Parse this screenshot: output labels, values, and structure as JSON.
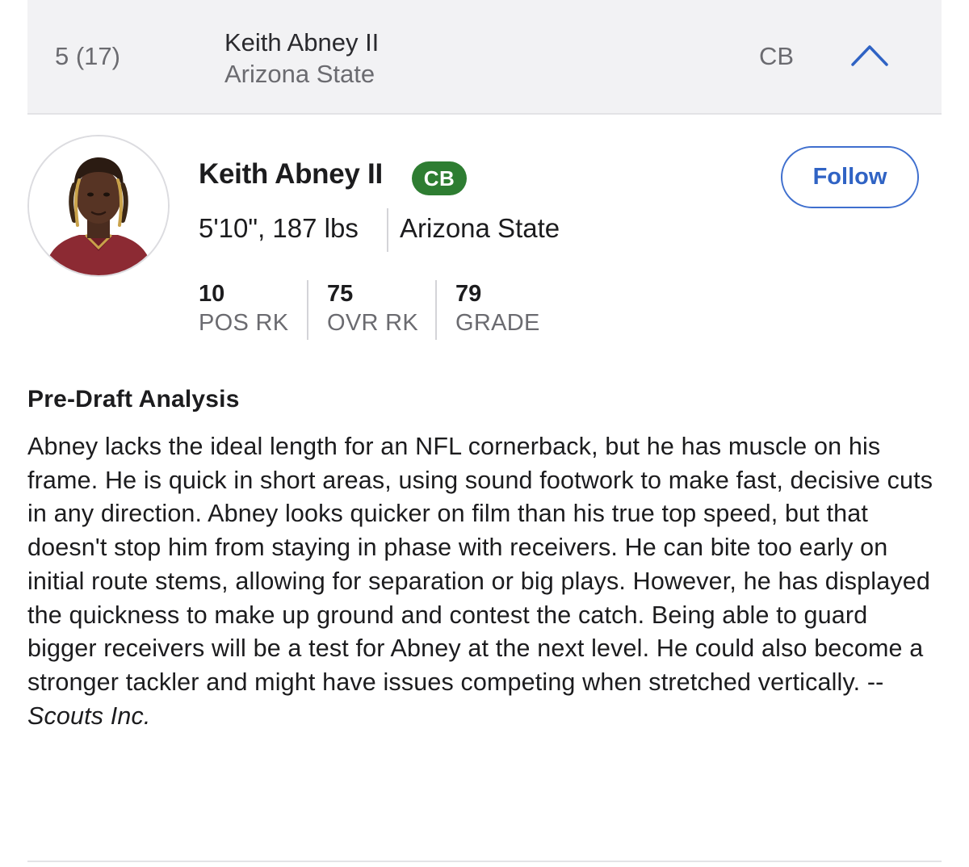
{
  "row": {
    "pick": "5 (17)",
    "name": "Keith Abney II",
    "school": "Arizona State",
    "position": "CB"
  },
  "player": {
    "name": "Keith Abney II",
    "position_badge": "CB",
    "measurements": "5'10\", 187 lbs",
    "school": "Arizona State",
    "follow_label": "Follow"
  },
  "stats": [
    {
      "value": "10",
      "label": "POS RK"
    },
    {
      "value": "75",
      "label": "OVR RK"
    },
    {
      "value": "79",
      "label": "GRADE"
    }
  ],
  "analysis": {
    "title": "Pre-Draft Analysis",
    "body": "Abney lacks the ideal length for an NFL cornerback, but he has muscle on his frame. He is quick in short areas, using sound footwork to make fast, decisive cuts in any direction. Abney looks quicker on film than his true top speed, but that doesn't stop him from staying in phase with receivers. He can bite too early on initial route stems, allowing for separation or big plays. However, he has displayed the quickness to make up ground and contest the catch. Being able to guard bigger receivers will be a test for Abney at the next level. He could also become a stronger tackler and might have issues competing when stretched vertically. -- ",
    "source": "Scouts Inc."
  },
  "colors": {
    "badge_green": "#2e7d32",
    "follow_blue": "#3063c4",
    "header_bg": "#f2f2f4"
  },
  "icons": {
    "collapse": "chevron-up-icon",
    "avatar": "player-headshot"
  }
}
